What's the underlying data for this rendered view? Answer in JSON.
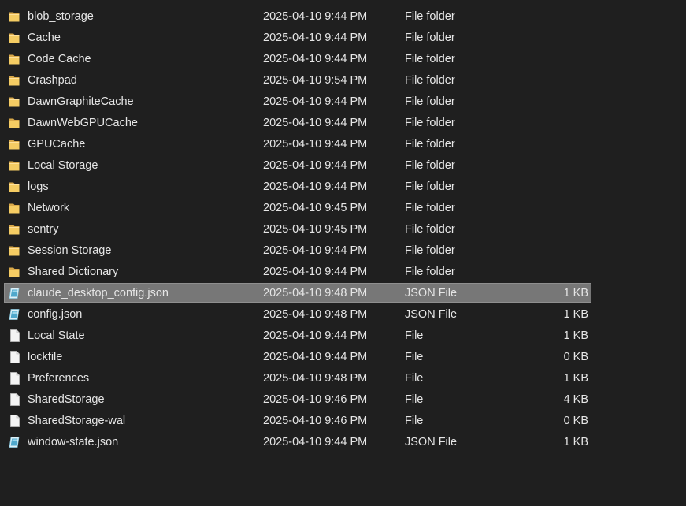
{
  "files": [
    {
      "name": "blob_storage",
      "date": "2025-04-10 9:44 PM",
      "type": "File folder",
      "size": "",
      "icon": "folder-icon",
      "selected": false
    },
    {
      "name": "Cache",
      "date": "2025-04-10 9:44 PM",
      "type": "File folder",
      "size": "",
      "icon": "folder-icon",
      "selected": false
    },
    {
      "name": "Code Cache",
      "date": "2025-04-10 9:44 PM",
      "type": "File folder",
      "size": "",
      "icon": "folder-icon",
      "selected": false
    },
    {
      "name": "Crashpad",
      "date": "2025-04-10 9:54 PM",
      "type": "File folder",
      "size": "",
      "icon": "folder-icon",
      "selected": false
    },
    {
      "name": "DawnGraphiteCache",
      "date": "2025-04-10 9:44 PM",
      "type": "File folder",
      "size": "",
      "icon": "folder-icon",
      "selected": false
    },
    {
      "name": "DawnWebGPUCache",
      "date": "2025-04-10 9:44 PM",
      "type": "File folder",
      "size": "",
      "icon": "folder-icon",
      "selected": false
    },
    {
      "name": "GPUCache",
      "date": "2025-04-10 9:44 PM",
      "type": "File folder",
      "size": "",
      "icon": "folder-icon",
      "selected": false
    },
    {
      "name": "Local Storage",
      "date": "2025-04-10 9:44 PM",
      "type": "File folder",
      "size": "",
      "icon": "folder-icon",
      "selected": false
    },
    {
      "name": "logs",
      "date": "2025-04-10 9:44 PM",
      "type": "File folder",
      "size": "",
      "icon": "folder-icon",
      "selected": false
    },
    {
      "name": "Network",
      "date": "2025-04-10 9:45 PM",
      "type": "File folder",
      "size": "",
      "icon": "folder-icon",
      "selected": false
    },
    {
      "name": "sentry",
      "date": "2025-04-10 9:45 PM",
      "type": "File folder",
      "size": "",
      "icon": "folder-icon",
      "selected": false
    },
    {
      "name": "Session Storage",
      "date": "2025-04-10 9:44 PM",
      "type": "File folder",
      "size": "",
      "icon": "folder-icon",
      "selected": false
    },
    {
      "name": "Shared Dictionary",
      "date": "2025-04-10 9:44 PM",
      "type": "File folder",
      "size": "",
      "icon": "folder-icon",
      "selected": false
    },
    {
      "name": "claude_desktop_config.json",
      "date": "2025-04-10 9:48 PM",
      "type": "JSON File",
      "size": "1 KB",
      "icon": "json-file-icon",
      "selected": true
    },
    {
      "name": "config.json",
      "date": "2025-04-10 9:48 PM",
      "type": "JSON File",
      "size": "1 KB",
      "icon": "json-file-icon",
      "selected": false
    },
    {
      "name": "Local State",
      "date": "2025-04-10 9:44 PM",
      "type": "File",
      "size": "1 KB",
      "icon": "file-icon",
      "selected": false
    },
    {
      "name": "lockfile",
      "date": "2025-04-10 9:44 PM",
      "type": "File",
      "size": "0 KB",
      "icon": "file-icon",
      "selected": false
    },
    {
      "name": "Preferences",
      "date": "2025-04-10 9:48 PM",
      "type": "File",
      "size": "1 KB",
      "icon": "file-icon",
      "selected": false
    },
    {
      "name": "SharedStorage",
      "date": "2025-04-10 9:46 PM",
      "type": "File",
      "size": "4 KB",
      "icon": "file-icon",
      "selected": false
    },
    {
      "name": "SharedStorage-wal",
      "date": "2025-04-10 9:46 PM",
      "type": "File",
      "size": "0 KB",
      "icon": "file-icon",
      "selected": false
    },
    {
      "name": "window-state.json",
      "date": "2025-04-10 9:44 PM",
      "type": "JSON File",
      "size": "1 KB",
      "icon": "json-file-icon",
      "selected": false
    }
  ],
  "colors": {
    "background": "#1f1f1f",
    "text": "#e6e6e6",
    "selection": "#777777",
    "folder": "#f2c75c",
    "json_icon": "#5fb8d9"
  }
}
